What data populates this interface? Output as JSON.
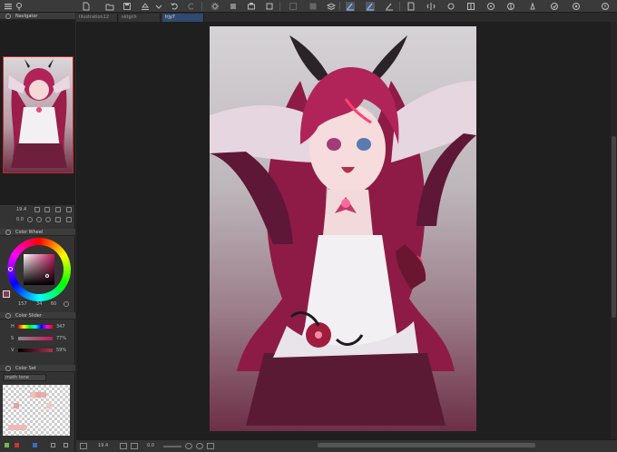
{
  "tabs": [
    "Illustration12",
    "sktgch",
    "lrjy7"
  ],
  "panels": {
    "navigator": {
      "title": "Navigator",
      "zoom": "19.4",
      "rotation": "0.0"
    },
    "color_wheel": {
      "title": "Color Wheel",
      "h": "157",
      "s": "34",
      "v": "60"
    },
    "color_slider": {
      "title": "Color Slider",
      "h_label": "H",
      "h_value": "347",
      "s_label": "S",
      "s_value": "77%",
      "v_label": "V",
      "v_value": "59%"
    },
    "color_set": {
      "title": "Color Set",
      "set_name": "math tone"
    }
  },
  "statusbar": {
    "zoom": "19.4",
    "rotation": "0.0"
  },
  "colors": {
    "accent": "#2f4a6e",
    "current_color": "#8a3a54",
    "hair": "#b0245a"
  },
  "icons": [
    "file-icon",
    "save-icon",
    "undo-icon",
    "redo-icon",
    "pen-icon",
    "brush-icon",
    "layer-icon",
    "gear-icon"
  ]
}
